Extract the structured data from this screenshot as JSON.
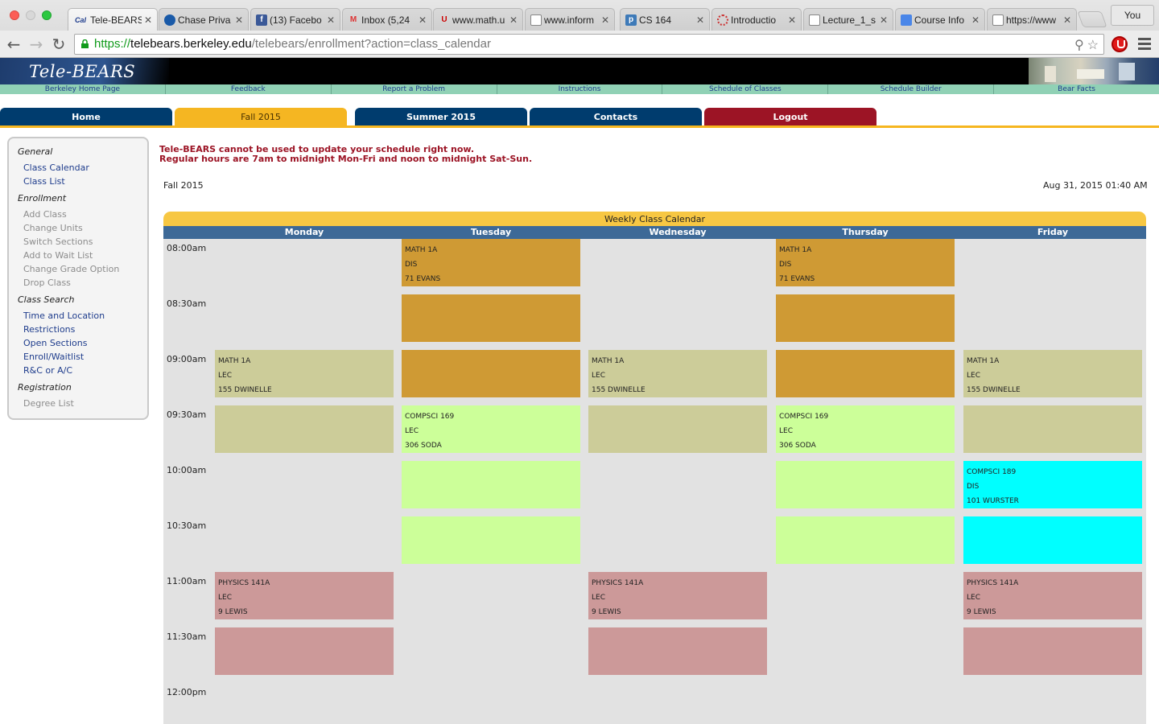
{
  "browser": {
    "tabs": [
      {
        "label": "Tele-BEARS",
        "icon": "cal-icon"
      },
      {
        "label": "Chase Priva",
        "icon": "chase-icon"
      },
      {
        "label": "(13) Facebo",
        "icon": "facebook-icon"
      },
      {
        "label": "Inbox (5,24",
        "icon": "gmail-icon"
      },
      {
        "label": "www.math.u",
        "icon": "utah-icon"
      },
      {
        "label": "www.inform",
        "icon": "page-icon"
      },
      {
        "label": "CS 164",
        "icon": "piazza-icon"
      },
      {
        "label": "Introductio",
        "icon": "loading-icon"
      },
      {
        "label": "Lecture_1_s",
        "icon": "page-icon"
      },
      {
        "label": "Course Info",
        "icon": "docs-icon"
      },
      {
        "label": "https://www",
        "icon": "page-icon"
      }
    ],
    "profile_label": "You",
    "url": {
      "scheme": "https://",
      "host": "telebears.berkeley.edu",
      "path": "/telebears/enrollment?action=class_calendar"
    }
  },
  "site": {
    "logo": "Tele-BEARS",
    "links": [
      "Berkeley Home Page",
      "Feedback",
      "Report a Problem",
      "Instructions",
      "Schedule of Classes",
      "Schedule Builder",
      "Bear Facts"
    ]
  },
  "main_tabs": [
    "Home",
    "Fall 2015",
    "Summer 2015",
    "Contacts",
    "Logout"
  ],
  "sidebar": {
    "sections": [
      {
        "title": "General",
        "items": [
          {
            "label": "Class Calendar",
            "enabled": true
          },
          {
            "label": "Class List",
            "enabled": true
          }
        ]
      },
      {
        "title": "Enrollment",
        "items": [
          {
            "label": "Add Class",
            "enabled": false
          },
          {
            "label": "Change Units",
            "enabled": false
          },
          {
            "label": "Switch Sections",
            "enabled": false
          },
          {
            "label": "Add to Wait List",
            "enabled": false
          },
          {
            "label": "Change Grade Option",
            "enabled": false
          },
          {
            "label": "Drop Class",
            "enabled": false
          }
        ]
      },
      {
        "title": "Class Search",
        "items": [
          {
            "label": "Time and Location",
            "enabled": true
          },
          {
            "label": "Restrictions",
            "enabled": true
          },
          {
            "label": "Open Sections",
            "enabled": true
          },
          {
            "label": "Enroll/Waitlist",
            "enabled": true
          },
          {
            "label": "R&C or A/C",
            "enabled": true
          }
        ]
      },
      {
        "title": "Registration",
        "items": [
          {
            "label": "Degree List",
            "enabled": false
          }
        ]
      }
    ]
  },
  "notice": {
    "line1": "Tele-BEARS cannot be used to update your schedule right now.",
    "line2": "Regular hours are 7am to midnight Mon-Fri and noon to midnight Sat-Sun."
  },
  "term": "Fall 2015",
  "timestamp": "Aug 31, 2015 01:40 AM",
  "calendar": {
    "title": "Weekly Class Calendar",
    "days": [
      "Monday",
      "Tuesday",
      "Wednesday",
      "Thursday",
      "Friday"
    ],
    "times": [
      "08:00am",
      "08:30am",
      "09:00am",
      "09:30am",
      "10:00am",
      "10:30am",
      "11:00am",
      "11:30am",
      "12:00pm"
    ],
    "colors": {
      "MATH 1A DIS": "#cf9a34",
      "MATH 1A LEC": "#cccc99",
      "COMPSCI 169 LEC": "#ccff99",
      "COMPSCI 189 DIS": "#00ffff",
      "PHYSICS 141A LEC": "#cc9999"
    },
    "events": [
      {
        "day": 1,
        "start": 0,
        "slots": 3,
        "course": "MATH 1A",
        "type": "DIS",
        "room": "71 EVANS",
        "color_key": "MATH 1A DIS"
      },
      {
        "day": 3,
        "start": 0,
        "slots": 3,
        "course": "MATH 1A",
        "type": "DIS",
        "room": "71 EVANS",
        "color_key": "MATH 1A DIS"
      },
      {
        "day": 0,
        "start": 2,
        "slots": 2,
        "course": "MATH 1A",
        "type": "LEC",
        "room": "155 DWINELLE",
        "color_key": "MATH 1A LEC"
      },
      {
        "day": 2,
        "start": 2,
        "slots": 2,
        "course": "MATH 1A",
        "type": "LEC",
        "room": "155 DWINELLE",
        "color_key": "MATH 1A LEC"
      },
      {
        "day": 4,
        "start": 2,
        "slots": 2,
        "course": "MATH 1A",
        "type": "LEC",
        "room": "155 DWINELLE",
        "color_key": "MATH 1A LEC"
      },
      {
        "day": 1,
        "start": 3,
        "slots": 3,
        "course": "COMPSCI 169",
        "type": "LEC",
        "room": "306 SODA",
        "color_key": "COMPSCI 169 LEC"
      },
      {
        "day": 3,
        "start": 3,
        "slots": 3,
        "course": "COMPSCI 169",
        "type": "LEC",
        "room": "306 SODA",
        "color_key": "COMPSCI 169 LEC"
      },
      {
        "day": 4,
        "start": 4,
        "slots": 2,
        "course": "COMPSCI 189",
        "type": "DIS",
        "room": "101 WURSTER",
        "color_key": "COMPSCI 189 DIS"
      },
      {
        "day": 0,
        "start": 6,
        "slots": 2,
        "course": "PHYSICS 141A",
        "type": "LEC",
        "room": "9 LEWIS",
        "color_key": "PHYSICS 141A LEC"
      },
      {
        "day": 2,
        "start": 6,
        "slots": 2,
        "course": "PHYSICS 141A",
        "type": "LEC",
        "room": "9 LEWIS",
        "color_key": "PHYSICS 141A LEC"
      },
      {
        "day": 4,
        "start": 6,
        "slots": 2,
        "course": "PHYSICS 141A",
        "type": "LEC",
        "room": "9 LEWIS",
        "color_key": "PHYSICS 141A LEC"
      }
    ]
  }
}
